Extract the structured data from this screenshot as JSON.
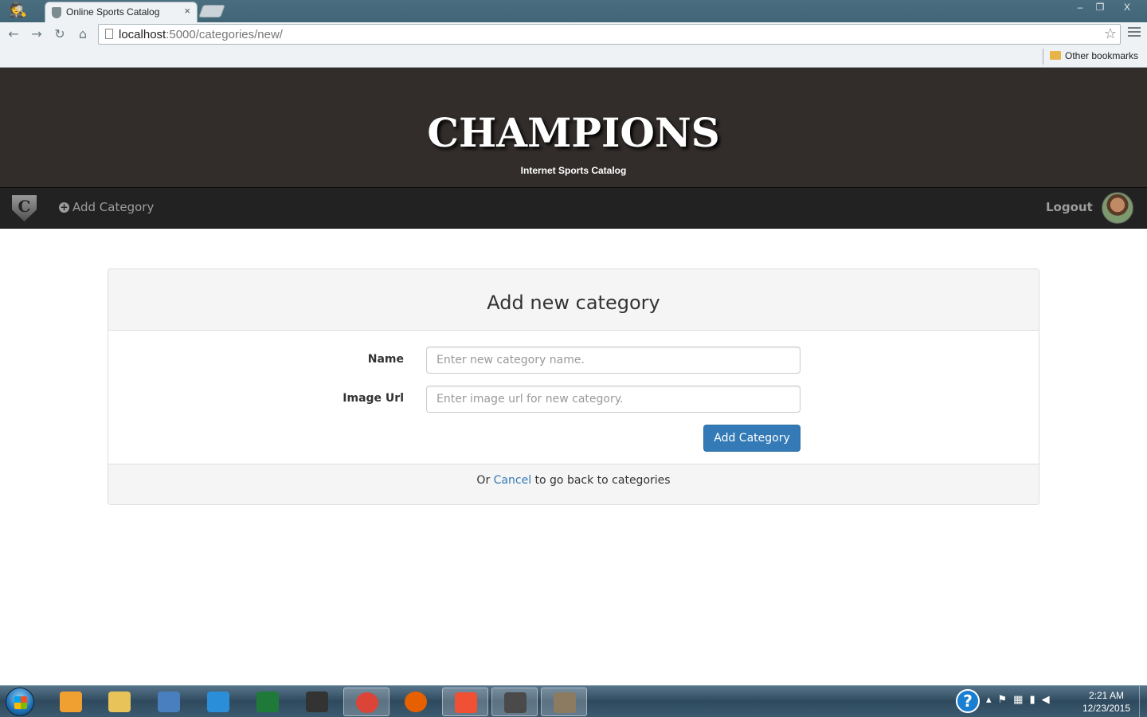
{
  "browser": {
    "tab_title": "Online Sports Catalog",
    "tab_close": "×",
    "url_host": "localhost",
    "url_path": ":5000/categories/new/",
    "bookmarks_other": "Other bookmarks",
    "window_minimize": "–",
    "window_restore": "❐",
    "window_close": "X"
  },
  "site": {
    "brand": "CHAMPIONS",
    "tagline": "Internet Sports Catalog",
    "logo_letter": "C"
  },
  "navbar": {
    "add_category": "Add Category",
    "logout": "Logout"
  },
  "form": {
    "title": "Add new category",
    "name_label": "Name",
    "name_placeholder": "Enter new category name.",
    "name_value": "",
    "image_label": "Image Url",
    "image_placeholder": "Enter image url for new category.",
    "image_value": "",
    "submit_label": "Add Category",
    "footer_prefix": "Or ",
    "footer_link": "Cancel",
    "footer_suffix": " to go back to categories"
  },
  "taskbar": {
    "apps": [
      {
        "name": "media-player",
        "color": "#f0a030"
      },
      {
        "name": "file-explorer",
        "color": "#e8c35a"
      },
      {
        "name": "python-file",
        "color": "#4a7fbf"
      },
      {
        "name": "network-app",
        "color": "#2a8fd8"
      },
      {
        "name": "terminal-app",
        "color": "#1f7a3a"
      },
      {
        "name": "printer-app",
        "color": "#333333"
      },
      {
        "name": "chrome",
        "color": "#db4437"
      },
      {
        "name": "firefox",
        "color": "#e66000"
      },
      {
        "name": "git",
        "color": "#f05033"
      },
      {
        "name": "sublime-text",
        "color": "#4a4a4a"
      },
      {
        "name": "gimp",
        "color": "#8c7b60"
      }
    ],
    "help_glyph": "?",
    "clock_time": "2:21 AM",
    "clock_date": "12/23/2015"
  }
}
